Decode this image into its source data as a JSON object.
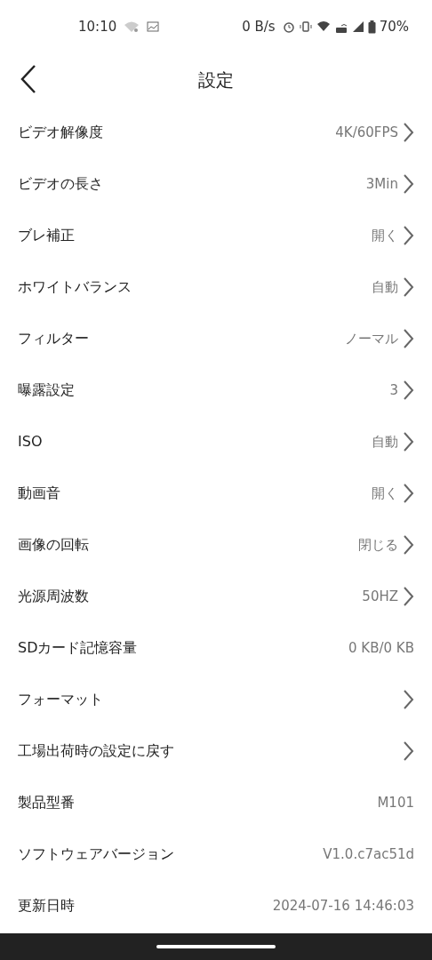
{
  "status_bar": {
    "time": "10:10",
    "net_speed": "0 B/s",
    "battery": "70%"
  },
  "header": {
    "title": "設定"
  },
  "rows": [
    {
      "label": "ビデオ解像度",
      "value": "4K/60FPS",
      "chevron": true
    },
    {
      "label": "ビデオの長さ",
      "value": "3Min",
      "chevron": true
    },
    {
      "label": "ブレ補正",
      "value": "開く",
      "chevron": true
    },
    {
      "label": "ホワイトバランス",
      "value": "自動",
      "chevron": true
    },
    {
      "label": "フィルター",
      "value": "ノーマル",
      "chevron": true
    },
    {
      "label": "曝露設定",
      "value": "3",
      "chevron": true
    },
    {
      "label": "ISO",
      "value": "自動",
      "chevron": true
    },
    {
      "label": "動画音",
      "value": "開く",
      "chevron": true
    },
    {
      "label": "画像の回転",
      "value": "閉じる",
      "chevron": true
    },
    {
      "label": "光源周波数",
      "value": "50HZ",
      "chevron": true
    },
    {
      "label": "SDカード記憶容量",
      "value": "0 KB/0 KB",
      "chevron": false
    },
    {
      "label": "フォーマット",
      "chevron": true
    },
    {
      "label": "工場出荷時の設定に戻す",
      "chevron": true
    },
    {
      "label": "製品型番",
      "value": "M101",
      "chevron": false
    },
    {
      "label": "ソフトウェアバージョン",
      "value": "V1.0.c7ac51d",
      "chevron": false
    },
    {
      "label": "更新日時",
      "value": "2024-07-16 14:46:03",
      "chevron": false
    }
  ]
}
